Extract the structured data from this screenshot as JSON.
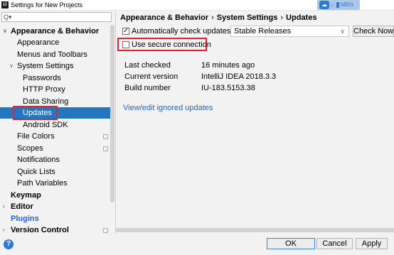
{
  "window": {
    "title": "Settings for New Projects",
    "app_icon": "intellij-idea-icon",
    "net_speed": "MB/s"
  },
  "sidebar": {
    "search": {
      "icon": "search-icon",
      "value": "",
      "placeholder": ""
    },
    "items": [
      {
        "label": "Appearance & Behavior"
      },
      {
        "label": "Appearance"
      },
      {
        "label": "Menus and Toolbars"
      },
      {
        "label": "System Settings"
      },
      {
        "label": "Passwords"
      },
      {
        "label": "HTTP Proxy"
      },
      {
        "label": "Data Sharing"
      },
      {
        "label": "Updates"
      },
      {
        "label": "Android SDK"
      },
      {
        "label": "File Colors"
      },
      {
        "label": "Scopes"
      },
      {
        "label": "Notifications"
      },
      {
        "label": "Quick Lists"
      },
      {
        "label": "Path Variables"
      },
      {
        "label": "Keymap"
      },
      {
        "label": "Editor"
      },
      {
        "label": "Plugins"
      },
      {
        "label": "Version Control"
      }
    ],
    "selected": "Updates"
  },
  "content": {
    "breadcrumb": [
      "Appearance & Behavior",
      "System Settings",
      "Updates"
    ],
    "breadcrumb_sep": "›",
    "auto_check": {
      "label": "Automatically check updates for",
      "checked": true
    },
    "channel_dropdown": {
      "value": "Stable Releases"
    },
    "check_now_label": "Check Now",
    "secure_connection": {
      "label": "Use secure connection",
      "checked": false
    },
    "info": [
      {
        "label": "Last checked",
        "value": "16 minutes ago"
      },
      {
        "label": "Current version",
        "value": "IntelliJ IDEA 2018.3.3"
      },
      {
        "label": "Build number",
        "value": "IU-183.5153.38"
      }
    ],
    "ignored_link": "View/edit ignored updates"
  },
  "footer": {
    "ok_label": "OK",
    "cancel_label": "Cancel",
    "apply_label": "Apply",
    "help_icon": "help-icon"
  },
  "colors": {
    "selection": "#2675bf",
    "highlight_box": "#e0232c",
    "link": "#2462d4"
  }
}
